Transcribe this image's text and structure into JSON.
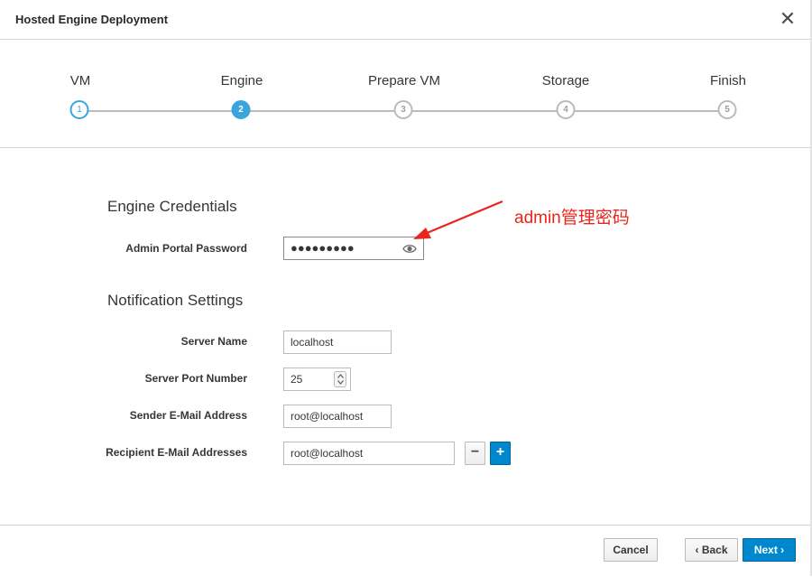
{
  "dialog": {
    "title": "Hosted Engine Deployment",
    "close_glyph": "✕"
  },
  "wizard": {
    "steps": [
      {
        "label": "VM",
        "number": "1",
        "state": "done"
      },
      {
        "label": "Engine",
        "number": "2",
        "state": "active"
      },
      {
        "label": "Prepare VM",
        "number": "3",
        "state": "pending"
      },
      {
        "label": "Storage",
        "number": "4",
        "state": "pending"
      },
      {
        "label": "Finish",
        "number": "5",
        "state": "pending"
      }
    ]
  },
  "engine_credentials": {
    "title": "Engine Credentials",
    "password_label": "Admin Portal Password",
    "password_mask": "●●●●●●●●●"
  },
  "notification": {
    "title": "Notification Settings",
    "server_name_label": "Server Name",
    "server_name_value": "localhost",
    "server_port_label": "Server Port Number",
    "server_port_value": "25",
    "sender_label": "Sender E-Mail Address",
    "sender_value": "root@localhost",
    "recipient_label": "Recipient E-Mail Addresses",
    "recipient_value": "root@localhost",
    "minus_glyph": "−",
    "plus_glyph": "+"
  },
  "annotation": {
    "text": "admin管理密码",
    "color": "#e8261c"
  },
  "footer": {
    "cancel_label": "Cancel",
    "back_label": "‹ Back",
    "next_label": "Next ›"
  },
  "colors": {
    "primary": "#0088ce",
    "wizard_active": "#39a5dc"
  }
}
